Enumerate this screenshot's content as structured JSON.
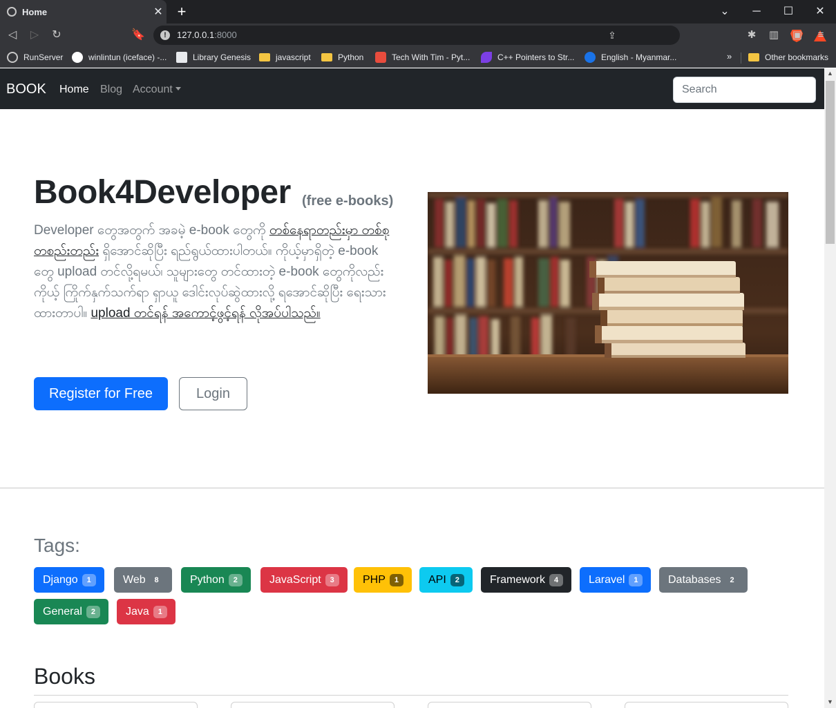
{
  "browser": {
    "tab_title": "Home",
    "url_host": "127.0.0.1",
    "url_port": ":8000",
    "bookmarks": [
      {
        "label": "RunServer",
        "icon": "globe-icon"
      },
      {
        "label": "winlintun (iceface) -...",
        "icon": "github-icon"
      },
      {
        "label": "Library Genesis",
        "icon": "book-icon"
      },
      {
        "label": "javascript",
        "icon": "folder-icon"
      },
      {
        "label": "Python",
        "icon": "folder-icon"
      },
      {
        "label": "Tech With Tim - Pyt...",
        "icon": "tim-icon"
      },
      {
        "label": "C++ Pointers to Str...",
        "icon": "cpp-icon"
      },
      {
        "label": "English - Myanmar...",
        "icon": "translate-icon"
      }
    ],
    "more_bookmarks": "»",
    "other_bookmarks": "Other bookmarks"
  },
  "nav": {
    "brand": "BOOK",
    "links": [
      "Home",
      "Blog",
      "Account"
    ],
    "search_placeholder": "Search"
  },
  "hero": {
    "title": "Book4Developer",
    "subtitle": "(free e-books)",
    "lead_part1": "Developer တွေအတွက် အခမဲ့ e-book တွေကို ",
    "lead_link1": "တစ်နေရာတည်းမှာ တစ်စုတစည်းတည်း",
    "lead_part2": " ရှိအောင်ဆိုပြီး ရည်ရွယ်ထားပါတယ်။ ကိုယ့်မှာရှိတဲ့ e-book တွေ upload တင်လို့ရမယ်၊ သူများတွေ တင်ထားတဲ့ e-book တွေကိုလည်း ကိုယ့် ကြိုက်နှက်သက်ရာ ရှာယူ ဒေါင်းလုပ်ဆွဲထားလို့ ရအောင်ဆိုပြီး ရေးသားထားတာပါ။ ",
    "lead_link2": "upload တင်ရန် အကောင့်ဖွင့်ရန် လိုအပ်ပါသည်။",
    "register_label": "Register for Free",
    "login_label": "Login"
  },
  "tags_section": {
    "heading": "Tags:",
    "tags": [
      {
        "name": "Django",
        "count": "1",
        "color": "#0d6efd"
      },
      {
        "name": "Web",
        "count": "8",
        "color": "#6c757d"
      },
      {
        "name": "Python",
        "count": "2",
        "color": "#198754"
      },
      {
        "name": "JavaScript",
        "count": "3",
        "color": "#dc3545"
      },
      {
        "name": "PHP",
        "count": "1",
        "color": "#ffc107"
      },
      {
        "name": "API",
        "count": "2",
        "color": "#0dcaf0"
      },
      {
        "name": "Framework",
        "count": "4",
        "color": "#212529"
      },
      {
        "name": "Laravel",
        "count": "1",
        "color": "#0d6efd"
      },
      {
        "name": "Databases",
        "count": "2",
        "color": "#6c757d"
      },
      {
        "name": "General",
        "count": "2",
        "color": "#198754"
      },
      {
        "name": "Java",
        "count": "1",
        "color": "#dc3545"
      }
    ]
  },
  "books_section": {
    "heading": "Books"
  }
}
